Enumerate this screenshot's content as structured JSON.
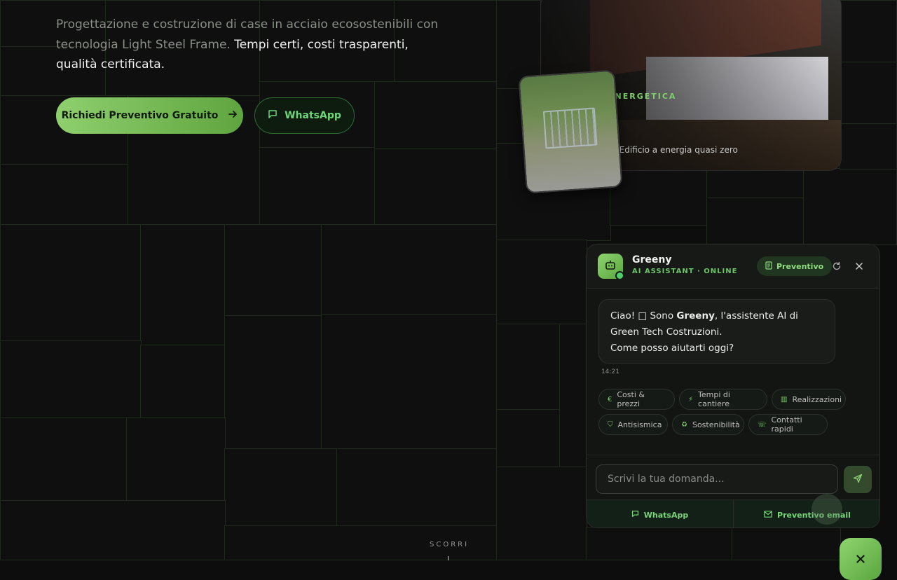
{
  "hero": {
    "description": "Progettazione e costruzione di case in acciaio ecosostenibili con tecnologia Light Steel Frame.",
    "highlight": "Tempi certi, costi trasparenti, qualità certificata.",
    "cta_primary": "Richiedi Preventivo Gratuito",
    "cta_whatsapp": "WhatsApp"
  },
  "house_card": {
    "tag": "ENERGETICA",
    "caption": "· Edificio a energia quasi zero"
  },
  "chat": {
    "bot_name": "Greeny",
    "bot_status": "AI ASSISTANT · ONLINE",
    "quote_button": "Preventivo",
    "message_line1_pre": "Ciao! □ Sono ",
    "message_bold": "Greeny",
    "message_line1_post": ", l'assistente AI di Green Tech Costruzioni.",
    "message_line2": "Come posso aiutarti oggi?",
    "message_time": "14:21",
    "chips": [
      {
        "label": "Costi & prezzi",
        "icon": "€"
      },
      {
        "label": "Tempi di cantiere",
        "icon": "⚡"
      },
      {
        "label": "Realizzazioni",
        "icon": "▥"
      },
      {
        "label": "Antisismica",
        "icon": "⛉"
      },
      {
        "label": "Sostenibilità",
        "icon": "♻"
      },
      {
        "label": "Contatti rapidi",
        "icon": "☏"
      }
    ],
    "input_placeholder": "Scrivi la tua domanda...",
    "footer_whatsapp": "WhatsApp",
    "footer_email": "Preventivo email"
  },
  "scroll_label": "SCORRI",
  "colors": {
    "accent": "#7fcf6a",
    "background": "#0d0d0d"
  }
}
